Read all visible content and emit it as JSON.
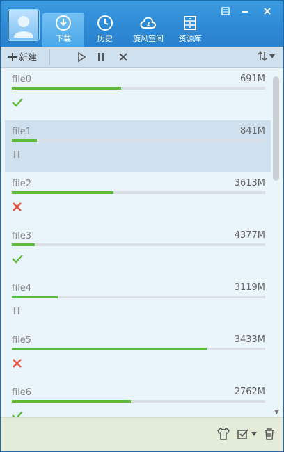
{
  "nav": {
    "download_label": "下载",
    "history_label": "历史",
    "whirlwind_label": "旋风空间",
    "resource_label": "资源库"
  },
  "toolbar": {
    "new_label": "新建"
  },
  "colors": {
    "accent": "#2f8bd6",
    "progress": "#5dbb3a",
    "error": "#e8553e",
    "selected": "#cfe1ef"
  },
  "downloads": [
    {
      "name": "file0",
      "size": "691M",
      "progress": 0.43,
      "status": "done"
    },
    {
      "name": "file1",
      "size": "841M",
      "progress": 0.1,
      "status": "paused"
    },
    {
      "name": "file2",
      "size": "3613M",
      "progress": 0.4,
      "status": "error"
    },
    {
      "name": "file3",
      "size": "4377M",
      "progress": 0.09,
      "status": "done"
    },
    {
      "name": "file4",
      "size": "3119M",
      "progress": 0.18,
      "status": "paused"
    },
    {
      "name": "file5",
      "size": "3433M",
      "progress": 0.77,
      "status": "error"
    },
    {
      "name": "file6",
      "size": "2762M",
      "progress": 0.47,
      "status": "done"
    }
  ]
}
